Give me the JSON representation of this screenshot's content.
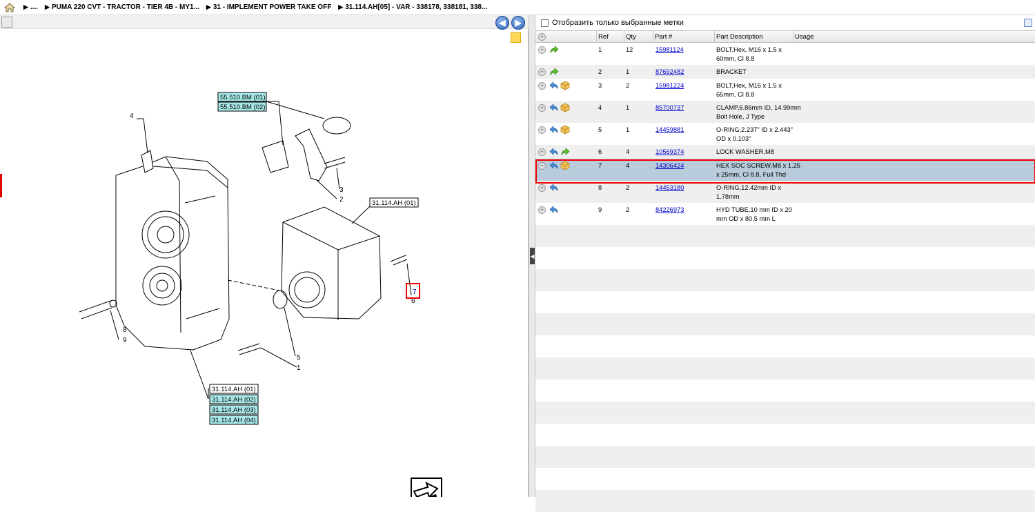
{
  "breadcrumb": {
    "items": [
      "....",
      "PUMA 220 CVT - TRACTOR - TIER 4B - MY1...",
      "31 - IMPLEMENT POWER TAKE OFF",
      "31.114.AH[05] - VAR - 338178, 338181, 338..."
    ]
  },
  "filter": {
    "label": "Отобразить только выбранные метки"
  },
  "columns": [
    "Ref",
    "Qty",
    "Part #",
    "Part Description",
    "Usage"
  ],
  "rows": [
    {
      "ref": "1",
      "qty": "12",
      "part": "15981124",
      "desc1": "BOLT,Hex, M16 x 1.5 x",
      "desc2": "60mm, Cl 8.8",
      "icons": [
        "green-arrow-icon"
      ],
      "selected": false
    },
    {
      "ref": "2",
      "qty": "1",
      "part": "87692482",
      "desc1": "BRACKET",
      "desc2": "",
      "icons": [
        "green-arrow-icon"
      ],
      "selected": false
    },
    {
      "ref": "3",
      "qty": "2",
      "part": "15981224",
      "desc1": "BOLT,Hex, M16 x 1.5 x",
      "desc2": "65mm, Cl 8.8",
      "icons": [
        "blue-return-icon",
        "package-icon"
      ],
      "selected": false
    },
    {
      "ref": "4",
      "qty": "1",
      "part": "85700737",
      "desc1": "CLAMP,6.86mm ID, 14.99mm",
      "desc2": "Bolt Hole, J Type",
      "icons": [
        "blue-return-icon",
        "package-icon"
      ],
      "selected": false
    },
    {
      "ref": "5",
      "qty": "1",
      "part": "14459881",
      "desc1": "O-RING,2.237\" ID x 2.443\"",
      "desc2": "OD x 0.103\"",
      "icons": [
        "blue-return-icon",
        "package-icon"
      ],
      "selected": false
    },
    {
      "ref": "6",
      "qty": "4",
      "part": "10569374",
      "desc1": "LOCK WASHER,M8",
      "desc2": "",
      "icons": [
        "blue-return-icon",
        "green-arrow-icon"
      ],
      "selected": false
    },
    {
      "ref": "7",
      "qty": "4",
      "part": "14306424",
      "desc1": "HEX SOC SCREW,M8 x 1.25",
      "desc2": "x 25mm, Cl 8.8, Full Thd",
      "icons": [
        "blue-return-icon",
        "package-icon"
      ],
      "selected": true
    },
    {
      "ref": "8",
      "qty": "2",
      "part": "14453180",
      "desc1": "O-RING,12.42mm ID x",
      "desc2": "1.78mm",
      "icons": [
        "blue-return-icon"
      ],
      "selected": false
    },
    {
      "ref": "9",
      "qty": "2",
      "part": "84226973",
      "desc1": "HYD TUBE,10 mm ID x 20",
      "desc2": "mm OD x 80.5 mm L",
      "icons": [
        "blue-return-icon"
      ],
      "selected": false
    }
  ],
  "diagram": {
    "callouts": [
      "1",
      "2",
      "3",
      "4",
      "5",
      "6",
      "7",
      "8",
      "9"
    ],
    "refs_top": [
      "55.510.BM (01)",
      "55.510.BM (02)"
    ],
    "ref_cover": "31.114.AH (01)",
    "refs_bottom": [
      "31.114.AH (01)",
      "31.114.AH (02)",
      "31.114.AH (03)",
      "31.114.AH (04)"
    ]
  },
  "colors": {
    "selected_row": "#b9ccdc",
    "highlight": "#e00000",
    "link": "#0000cc",
    "ref_fill": "#a8e8e8"
  }
}
